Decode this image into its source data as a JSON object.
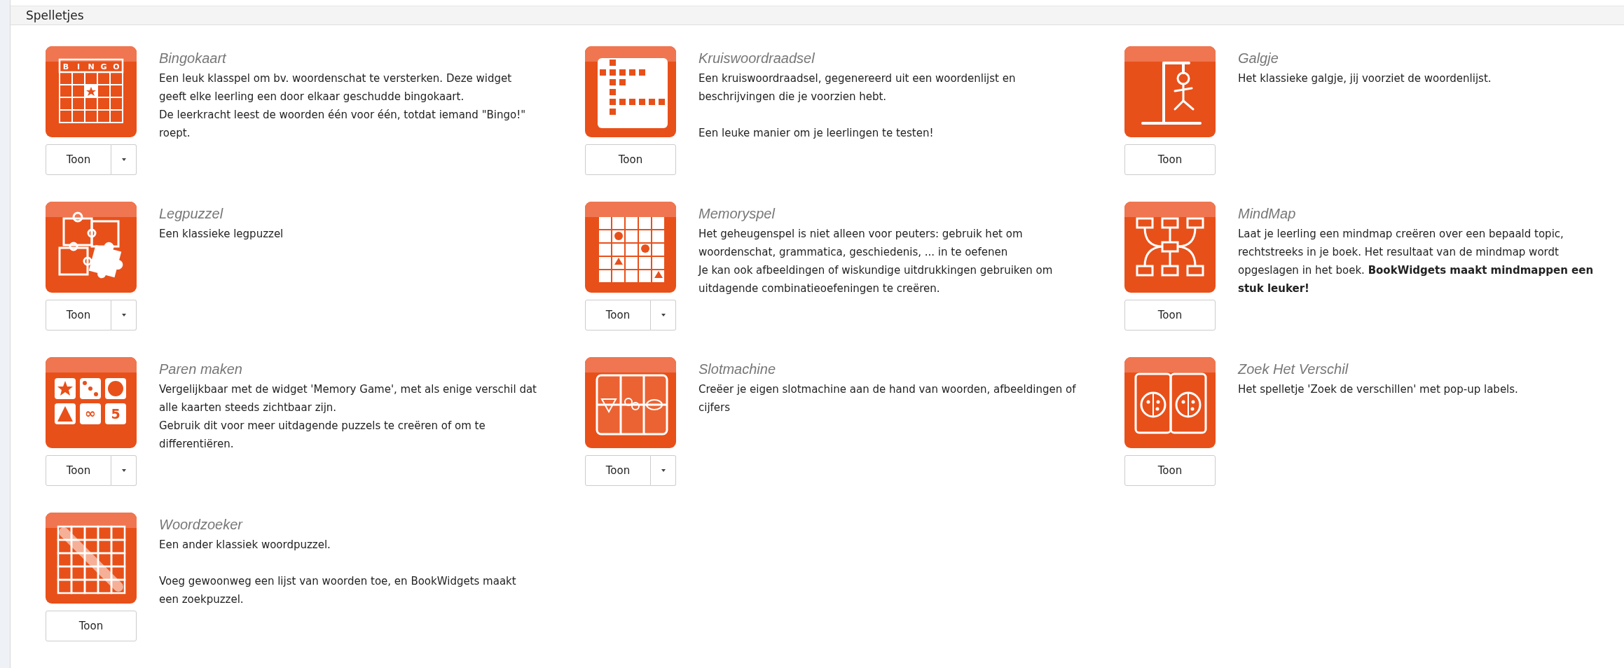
{
  "panel": {
    "title": "Spelletjes"
  },
  "widgets": [
    {
      "title": "Bingokaart",
      "kind": "bingo",
      "icon_letters": [
        "B",
        "I",
        "N",
        "G",
        "O"
      ],
      "text": "Een leuk klasspel om bv. woordenschat te versterken. Deze widget geeft elke leerling een door elkaar geschudde bingokaart.\nDe leerkracht leest de woorden één voor één, totdat iemand \"Bingo!\" roept.",
      "button": "Toon",
      "split": true
    },
    {
      "title": "Kruiswoordraadsel",
      "kind": "crossword",
      "text": "Een kruiswoordraadsel, gegenereerd uit een woordenlijst en beschrijvingen die je voorzien hebt.\n\nEen leuke manier om je leerlingen te testen!",
      "button": "Toon",
      "split": false
    },
    {
      "title": "Galgje",
      "kind": "hangman",
      "text": "Het klassieke galgje, jij voorziet de woordenlijst.",
      "button": "Toon",
      "split": false
    },
    {
      "title": "Legpuzzel",
      "kind": "puzzle",
      "text": "Een klassieke legpuzzel",
      "button": "Toon",
      "split": true
    },
    {
      "title": "Memoryspel",
      "kind": "memory",
      "text": "Het geheugenspel is niet alleen voor peuters: gebruik het om woordenschat, grammatica, geschiedenis, ... in te oefenen\nJe kan ook afbeeldingen of wiskundige uitdrukkingen gebruiken om uitdagende combinatieoefeningen te creëren.",
      "button": "Toon",
      "split": true
    },
    {
      "title": "MindMap",
      "kind": "mindmap",
      "text": "Laat je leerling een mindmap creëren over een bepaald topic, rechtstreeks in je boek. Het resultaat van de mindmap wordt opgeslagen in het boek. **BookWidgets maakt mindmappen een stuk leuker!**",
      "button": "Toon",
      "split": false
    },
    {
      "title": "Paren maken",
      "kind": "pairs",
      "icon_letters": [
        "∞",
        "5"
      ],
      "text": "Vergelijkbaar met de widget 'Memory Game', met als enige verschil dat alle kaarten steeds zichtbaar zijn.\nGebruik dit voor meer uitdagende puzzels te creëren of om te differentiëren.",
      "button": "Toon",
      "split": true
    },
    {
      "title": "Slotmachine",
      "kind": "slot",
      "text": "Creëer je eigen slotmachine aan de hand van woorden, afbeeldingen of cijfers",
      "button": "Toon",
      "split": true
    },
    {
      "title": "Zoek Het Verschil",
      "kind": "difference",
      "text": "Het spelletje 'Zoek de verschillen' met pop-up labels.",
      "button": "Toon",
      "split": false
    },
    {
      "title": "Woordzoeker",
      "kind": "wordsearch",
      "text": "Een ander klassiek woordpuzzel.\n\nVoeg gewoonweg een lijst van woorden toe, en BookWidgets maakt een zoekpuzzel.",
      "button": "Toon",
      "split": false
    }
  ]
}
